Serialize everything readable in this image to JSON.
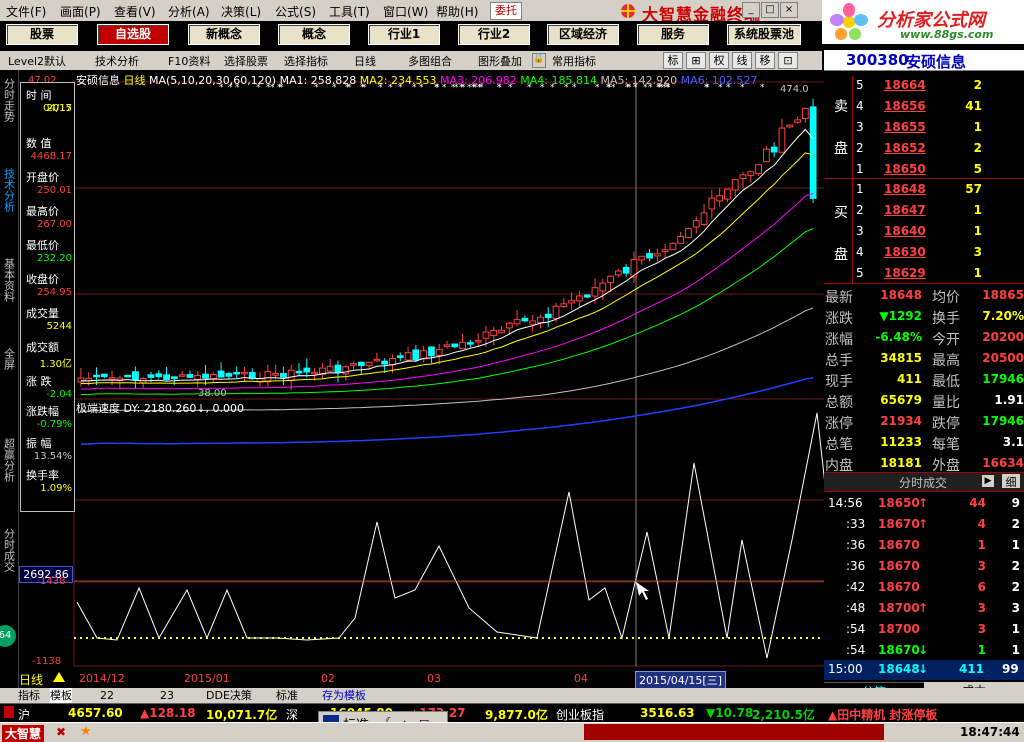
{
  "menu": [
    "文件",
    "画面",
    "查看",
    "分析",
    "决策",
    "公式",
    "工具",
    "窗口",
    "帮助"
  ],
  "menu_keys": [
    "(F)",
    "(P)",
    "(V)",
    "(A)",
    "(L)",
    "(S)",
    "(T)",
    "(W)",
    "(H)"
  ],
  "weituo": "委托",
  "app_title": "大智慧金融终端",
  "brand": {
    "name": "分析家公式网",
    "url": "www.88gs.com"
  },
  "nav": [
    "股票",
    "自选股",
    "新概念",
    "概念",
    "行业1",
    "行业2",
    "区域经济",
    "服务",
    "系统股票池"
  ],
  "nav_active": 1,
  "toolbar": {
    "items": [
      "Level2默认",
      "技术分析",
      "F10资料",
      "选择股票",
      "选择指标",
      "日线",
      "多图组合",
      "图形叠加",
      "常用指标"
    ],
    "icons": [
      "标",
      "⊞",
      "权",
      "线",
      "移",
      "⊡"
    ]
  },
  "left_tabs": [
    "分时走势",
    "技术分析",
    "基本资料",
    "全屏",
    "超赢分析",
    "分时成交"
  ],
  "left_tab_active": 1,
  "chart_header": {
    "name": "安硕信息",
    "period": "日线",
    "ma_def": "MA(5,10,20,30,60,120)",
    "ma1": "MA1: 258.828",
    "ma2": "MA2: 234.553",
    "ma3": "MA3: 206.982",
    "ma4": "MA4: 185.814",
    "ma5": "MA5: 142.920",
    "ma6": "MA6: 102.527",
    "top_left_price": "47.02",
    "high_label": "474.0",
    "low_label": "38.00"
  },
  "infobox": [
    {
      "label": "时  间",
      "value": "2015"
    },
    {
      "label": "",
      "value": "04/17"
    },
    {
      "label": "数  值",
      "value": "4468.17"
    },
    {
      "label": "开盘价",
      "value": "250.01"
    },
    {
      "label": "最高价",
      "value": "267.00"
    },
    {
      "label": "最低价",
      "value": "232.20"
    },
    {
      "label": "收盘价",
      "value": "254.95"
    },
    {
      "label": "成交量",
      "value": "5244"
    },
    {
      "label": "成交额",
      "value": "1.30亿"
    },
    {
      "label": "涨  跌",
      "value": "-2.04"
    },
    {
      "label": "涨跌幅",
      "value": "-0.79%"
    },
    {
      "label": "振  幅",
      "value": "13.54%"
    },
    {
      "label": "换手率",
      "value": "1.09%"
    }
  ],
  "indicator": {
    "title": "极端速度",
    "text": "DY: 2180.260↓, 0.000",
    "y_label": "2692.86",
    "y_label2": "1438",
    "y_label3": "-1138"
  },
  "date_axis": {
    "labels": [
      "2014/12",
      "2015/01",
      "02",
      "03",
      "04"
    ],
    "cursor_date": "2015/04/15[三]"
  },
  "period_label": "日线",
  "stock": {
    "code": "300380",
    "name": "安硕信息"
  },
  "sell": [
    {
      "n": "5",
      "price": "18664",
      "vol": "2"
    },
    {
      "n": "4",
      "price": "18656",
      "vol": "41"
    },
    {
      "n": "3",
      "price": "18655",
      "vol": "1"
    },
    {
      "n": "2",
      "price": "18652",
      "vol": "2"
    },
    {
      "n": "1",
      "price": "18650",
      "vol": "5"
    }
  ],
  "buy": [
    {
      "n": "1",
      "price": "18648",
      "vol": "57"
    },
    {
      "n": "2",
      "price": "18647",
      "vol": "1"
    },
    {
      "n": "3",
      "price": "18640",
      "vol": "1"
    },
    {
      "n": "4",
      "price": "18630",
      "vol": "3"
    },
    {
      "n": "5",
      "price": "18629",
      "vol": "1"
    }
  ],
  "sell_label": [
    "卖",
    "盘"
  ],
  "buy_label": [
    "买",
    "盘"
  ],
  "quote": [
    {
      "l1": "最新",
      "v1": "18648",
      "l2": "均价",
      "v2": "18865"
    },
    {
      "l1": "涨跌",
      "v1": "▼1292",
      "l2": "换手",
      "v2": "7.20%"
    },
    {
      "l1": "涨幅",
      "v1": "-6.48%",
      "l2": "今开",
      "v2": "20200"
    },
    {
      "l1": "总手",
      "v1": "34815",
      "l2": "最高",
      "v2": "20500"
    },
    {
      "l1": "现手",
      "v1": "411",
      "l2": "最低",
      "v2": "17946"
    },
    {
      "l1": "总额",
      "v1": "65679",
      "l2": "量比",
      "v2": "1.91"
    },
    {
      "l1": "涨停",
      "v1": "21934",
      "l2": "跌停",
      "v2": "17946"
    },
    {
      "l1": "总笔",
      "v1": "11233",
      "l2": "每笔",
      "v2": "3.1"
    },
    {
      "l1": "内盘",
      "v1": "18181",
      "l2": "外盘",
      "v2": "16634"
    }
  ],
  "ticks_title": "分时成交",
  "ticks_fine": "细",
  "ticks": [
    {
      "t": "14:56",
      "p": "18650",
      "d": "↑",
      "v": "44",
      "n": "9"
    },
    {
      "t": ":33",
      "p": "18670",
      "d": "↑",
      "v": "4",
      "n": "2"
    },
    {
      "t": ":36",
      "p": "18670",
      "d": "",
      "v": "1",
      "n": "1"
    },
    {
      "t": ":36",
      "p": "18670",
      "d": "",
      "v": "3",
      "n": "2"
    },
    {
      "t": ":42",
      "p": "18670",
      "d": "",
      "v": "6",
      "n": "2"
    },
    {
      "t": ":48",
      "p": "18700",
      "d": "↑",
      "v": "3",
      "n": "3"
    },
    {
      "t": ":54",
      "p": "18700",
      "d": "",
      "v": "3",
      "n": "1"
    },
    {
      "t": ":54",
      "p": "18670",
      "d": "↓",
      "v": "1",
      "n": "1"
    }
  ],
  "last_tick": {
    "t": "15:00",
    "p": "18648",
    "d": "↓",
    "v": "411",
    "n": "99"
  },
  "rp_tabs": [
    "分笔",
    "成本"
  ],
  "bottom_tabs": [
    "指标",
    "模板",
    "22",
    "23",
    "DDE决策",
    "标准",
    "存为模板"
  ],
  "ticker": {
    "hu": "沪",
    "hu_val": "4657.60",
    "hu_chg": "▲128.18",
    "hu_amt": "10,071.7亿",
    "shen": "深",
    "shen_val": "16045.80",
    "shen_chg": "▲173.27",
    "shen_amt": "9,877.0亿",
    "cy": "创业板指",
    "cy_val": "3516.63",
    "cy_chg": "▼10.78",
    "cy_amt": "2,210.5亿",
    "news": "▲田中精机 封涨停板"
  },
  "status": {
    "app": "大智慧",
    "mode": "标准",
    "time": "18:47:44"
  },
  "colors": {
    "up": "#ff4040",
    "down": "#00ffff",
    "ma1": "#ffffff",
    "ma2": "#ffff00",
    "ma3": "#ff00ff",
    "ma4": "#00ff00",
    "ma5": "#c0c0c0",
    "ma6": "#4040ff"
  }
}
